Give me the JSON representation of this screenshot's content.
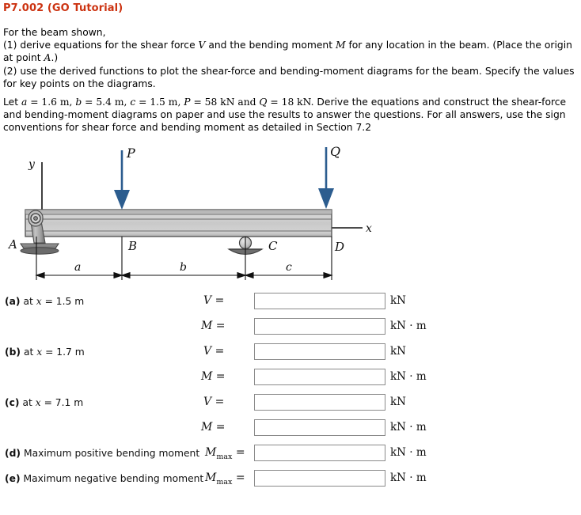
{
  "header": {
    "problem_id": "P7.002 (GO Tutorial)"
  },
  "statement": {
    "line1": "For the beam shown,",
    "line2_a": "(1)  derive equations for the shear force ",
    "line2_V": "V",
    "line2_b": " and the bending moment ",
    "line2_M": "M",
    "line2_c": " for any location in the beam.  (Place the origin at point ",
    "line2_A": "A",
    "line2_d": ".)",
    "line3": "(2)  use the derived functions to plot the shear-force and bending-moment diagrams for the beam.  Specify the values for key points on the diagrams."
  },
  "parameters": {
    "intro": "Let ",
    "a_sym": "a",
    "a_val": " = 1.6 m, ",
    "b_sym": "b",
    "b_val": " = 5.4 m, ",
    "c_sym": "c",
    "c_val": " = 1.5 m, ",
    "P_sym": "P",
    "P_val": " = 58 kN and ",
    "Q_sym": "Q",
    "Q_val": " = 18 kN.",
    "tail": "  Derive the equations and construct the shear-force and bending-moment diagrams on paper and use the results to answer the questions.  For all answers, use the sign conventions for shear force and bending moment as detailed in Section 7.2",
    "values": {
      "a": "1.6 m",
      "b": "5.4 m",
      "c": "1.5 m",
      "P": "58 kN",
      "Q": "18 kN"
    }
  },
  "figure": {
    "axis_y_label": "y",
    "axis_x_label": "x",
    "load_P_label": "P",
    "load_Q_label": "Q",
    "point_A_label": "A",
    "point_B_label": "B",
    "point_C_label": "C",
    "point_D_label": "D",
    "dim_a_label": "a",
    "dim_b_label": "b",
    "dim_c_label": "c",
    "colors": {
      "load_arrow": "#2C5D8F",
      "beam_fill": "#C8C8C8",
      "beam_edge": "#555555",
      "support_dark": "#6E6E6E"
    }
  },
  "answers": {
    "box_placeholder": "",
    "rows": [
      {
        "tag": "(a)",
        "label": " at x = 1.5 m",
        "label_pre": "(a)",
        "label_mid": " at ",
        "label_x": "x",
        "label_post": " = 1.5 m",
        "symbol": "V",
        "symbol_sub": "",
        "eq": " =",
        "value": "",
        "unit": "kN"
      },
      {
        "tag": "",
        "label": "",
        "label_pre": "",
        "label_mid": "",
        "label_x": "",
        "label_post": "",
        "symbol": "M",
        "symbol_sub": "",
        "eq": " =",
        "value": "",
        "unit": "kN · m"
      },
      {
        "tag": "(b)",
        "label": " at x = 1.7 m",
        "label_pre": "(b)",
        "label_mid": " at ",
        "label_x": "x",
        "label_post": " = 1.7 m",
        "symbol": "V",
        "symbol_sub": "",
        "eq": " =",
        "value": "",
        "unit": "kN"
      },
      {
        "tag": "",
        "label": "",
        "label_pre": "",
        "label_mid": "",
        "label_x": "",
        "label_post": "",
        "symbol": "M",
        "symbol_sub": "",
        "eq": " =",
        "value": "",
        "unit": "kN · m"
      },
      {
        "tag": "(c)",
        "label": " at x = 7.1 m",
        "label_pre": "(c)",
        "label_mid": " at ",
        "label_x": "x",
        "label_post": " = 7.1 m",
        "symbol": "V",
        "symbol_sub": "",
        "eq": " =",
        "value": "",
        "unit": "kN"
      },
      {
        "tag": "",
        "label": "",
        "label_pre": "",
        "label_mid": "",
        "label_x": "",
        "label_post": "",
        "symbol": "M",
        "symbol_sub": "",
        "eq": " =",
        "value": "",
        "unit": "kN · m"
      },
      {
        "tag": "(d)",
        "label": " Maximum positive bending moment",
        "label_pre": "(d)",
        "label_mid": " Maximum positive bending moment",
        "label_x": "",
        "label_post": "",
        "symbol": "M",
        "symbol_sub": "max",
        "eq": " =",
        "value": "",
        "unit": "kN · m"
      },
      {
        "tag": "(e)",
        "label": " Maximum negative bending moment",
        "label_pre": "(e)",
        "label_mid": " Maximum negative bending moment",
        "label_x": "",
        "label_post": "",
        "symbol": "M",
        "symbol_sub": "max",
        "eq": " =",
        "value": "",
        "unit": "kN · m"
      }
    ]
  }
}
